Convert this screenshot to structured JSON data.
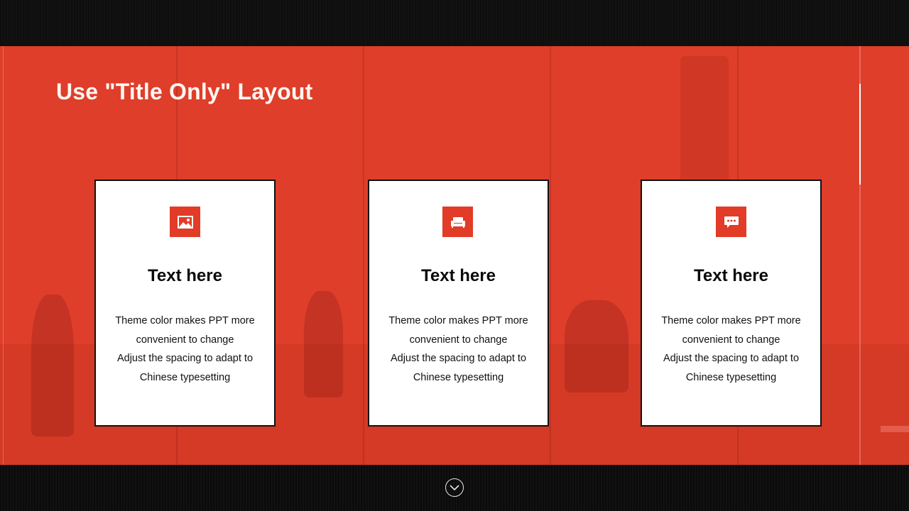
{
  "slide": {
    "title": "Use \"Title Only\" Layout"
  },
  "cards": [
    {
      "icon": "picture-icon",
      "heading": "Text here",
      "body": [
        "Theme  color makes PPT more",
        "convenient  to change",
        "Adjust the spacing to adapt to",
        "Chinese  typesetting"
      ]
    },
    {
      "icon": "sofa-icon",
      "heading": "Text here",
      "body": [
        "Theme  color makes PPT more",
        "convenient  to change",
        "Adjust the spacing to adapt to",
        "Chinese  typesetting"
      ]
    },
    {
      "icon": "chat-icon",
      "heading": "Text here",
      "body": [
        "Theme  color makes PPT more",
        "convenient  to change",
        "Adjust the spacing to adapt to",
        "Chinese  typesetting"
      ]
    }
  ],
  "navigation": {
    "next_icon": "chevron-down-circle-icon"
  },
  "colors": {
    "accent": "#de3e2a",
    "icon_bg": "#e23b27",
    "frame": "#0d0d0d",
    "card_bg": "#ffffff"
  }
}
